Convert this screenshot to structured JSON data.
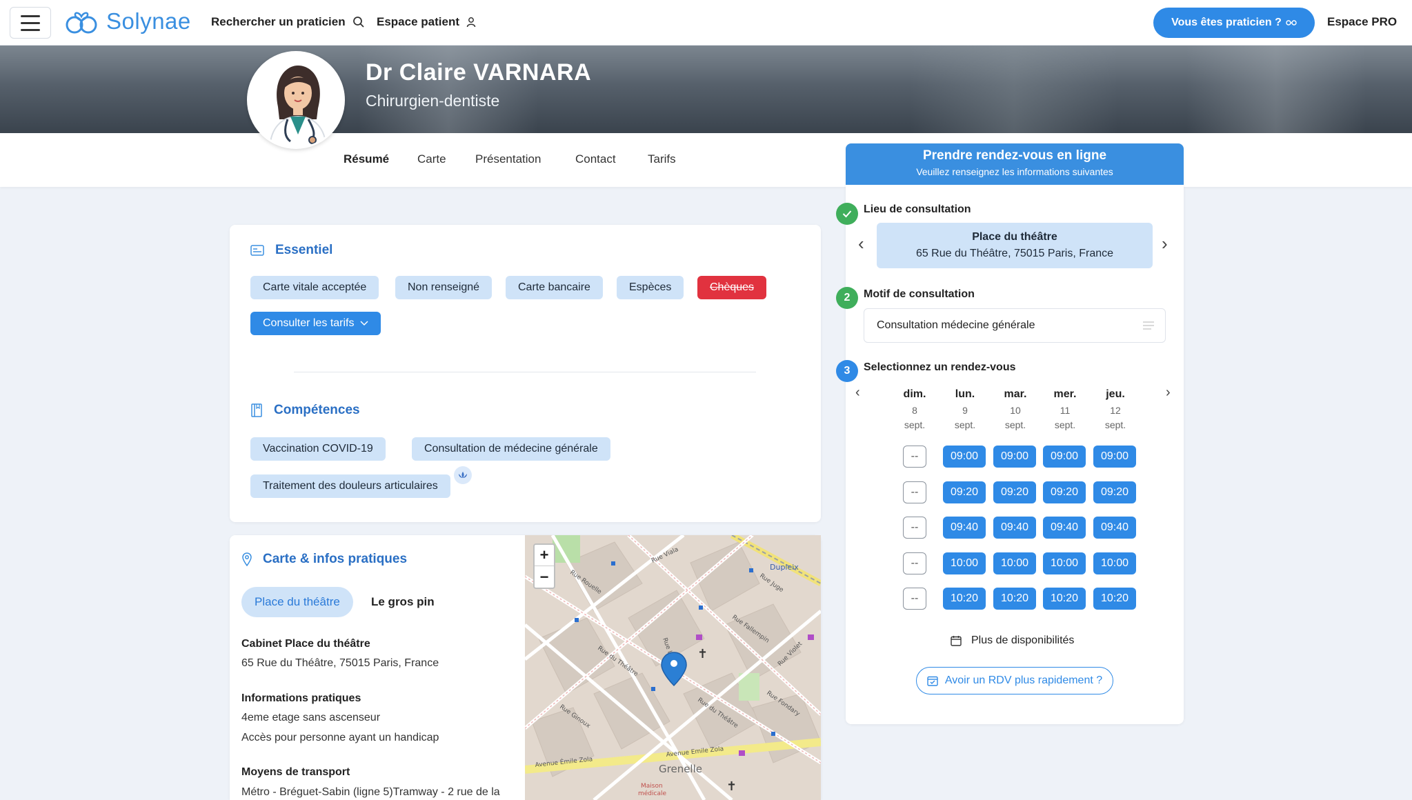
{
  "brand": {
    "name": "Solynae",
    "accent": "#2f8ae6",
    "success": "#3fae5b",
    "danger": "#e1323f"
  },
  "nav": {
    "search_label": "Rechercher un praticien",
    "patient_label": "Espace patient",
    "pro_cta": "Vous êtes praticien ?",
    "pro_space": "Espace PRO"
  },
  "doctor": {
    "name": "Dr Claire VARNARA",
    "specialty": "Chirurgien-dentiste"
  },
  "tabs": [
    {
      "label": "Résumé",
      "active": true
    },
    {
      "label": "Carte"
    },
    {
      "label": "Présentation"
    },
    {
      "label": "Contact"
    },
    {
      "label": "Tarifs"
    }
  ],
  "essentiel": {
    "title": "Essentiel",
    "chips": [
      "Carte vitale acceptée",
      "Non renseigné",
      "Carte bancaire",
      "Espèces",
      "Chèques"
    ],
    "tarifs_button": "Consulter les tarifs"
  },
  "competences": {
    "title": "Compétences",
    "chips": [
      "Vaccination COVID-19",
      "Consultation de médecine générale",
      "Traitement des douleurs articulaires"
    ]
  },
  "carte": {
    "title": "Carte & infos pratiques",
    "pills": [
      "Place du théâtre",
      "Le gros pin"
    ],
    "cabinet_title": "Cabinet Place du théâtre",
    "cabinet_address": "65 Rue du Théâtre, 75015 Paris, France",
    "infos_title": "Informations pratiques",
    "infos_lines": [
      "4eme etage sans ascenseur",
      "Accès pour personne ayant un handicap"
    ],
    "transport_title": "Moyens de transport",
    "transport_text": "Métro - Bréguet-Sabin (ligne 5)Tramway - 2 rue de la",
    "map_labels": {
      "dupleix": "Dupleix",
      "grenelle": "Grenelle",
      "avenue": "Avenue Emile Zola",
      "avenue2": "Avenue Émile Zola",
      "maison": "Maison",
      "medicale": "médicale",
      "streets": [
        "Rue Viala",
        "Rue Rouelle",
        "Rue du Théâtre",
        "Rue Fallempin",
        "Rue Juge",
        "Rue Ginoux",
        "Rue Fondary",
        "Rue Violet",
        "Rue Letellier",
        "Rue du Théâtre"
      ]
    }
  },
  "booking": {
    "title": "Prendre rendez-vous en ligne",
    "subtitle": "Veuillez renseignez les informations suivantes",
    "step1_label": "Lieu de consultation",
    "step2_num": "2",
    "step2_label": "Motif de consultation",
    "step3_num": "3",
    "step3_label": "Selectionnez un rendez-vous",
    "place_name": "Place du théâtre",
    "place_address": "65 Rue du Théâtre, 75015 Paris, France",
    "motif_value": "Consultation médecine générale",
    "days": [
      {
        "name": "dim.",
        "num": "8",
        "month": "sept."
      },
      {
        "name": "lun.",
        "num": "9",
        "month": "sept."
      },
      {
        "name": "mar.",
        "num": "10",
        "month": "sept."
      },
      {
        "name": "mer.",
        "num": "11",
        "month": "sept."
      },
      {
        "name": "jeu.",
        "num": "12",
        "month": "sept."
      }
    ],
    "empty_slot": "--",
    "times": [
      "09:00",
      "09:20",
      "09:40",
      "10:00",
      "10:20"
    ],
    "more": "Plus de disponibilités",
    "faster": "Avoir un RDV plus rapidement ?"
  }
}
